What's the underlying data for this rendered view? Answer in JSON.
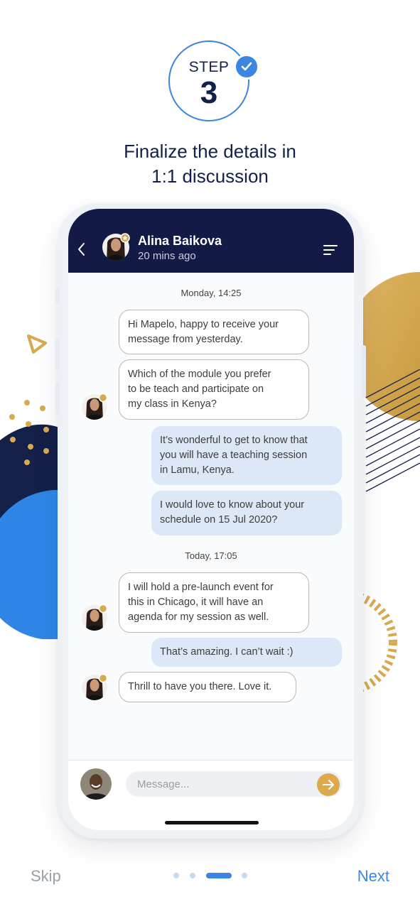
{
  "colors": {
    "accent": "#3b86e0",
    "navy": "#121a45",
    "gold": "#d7aa4f"
  },
  "step": {
    "label": "STEP",
    "number": "3",
    "icon": "checkmark-icon"
  },
  "headline": {
    "line1": "Finalize the details in",
    "line2": "1:1 discussion"
  },
  "chat": {
    "contact_name": "Alina Baikova",
    "contact_status": "20 mins ago",
    "icons": {
      "back": "chevron-left-icon",
      "menu": "filter-menu-icon",
      "favorite": "star-badge-icon"
    },
    "groups": [
      {
        "date": "Monday, 14:25"
      },
      {
        "date": "Today, 17:05"
      }
    ],
    "messages": [
      {
        "from": "contact",
        "text": "Hi Mapelo, happy to receive your\nmessage from yesterday."
      },
      {
        "from": "contact",
        "text": "Which of the module you prefer\nto be teach and participate on\nmy class in Kenya?"
      },
      {
        "from": "me",
        "text": "It’s wonderful to get to know that\nyou will have a teaching session\nin Lamu, Kenya."
      },
      {
        "from": "me",
        "text": "I would love to know about your\nschedule on 15 Jul 2020?"
      },
      {
        "from": "contact",
        "text": "I will hold a pre-launch event for\nthis in Chicago, it will have an\nagenda for my session as well."
      },
      {
        "from": "me",
        "text": "That’s amazing. I can’t wait :)"
      },
      {
        "from": "contact",
        "text": "Thrill to have you there. Love it."
      }
    ],
    "composer": {
      "placeholder": "Message...",
      "value": "",
      "send_icon": "arrow-right-icon"
    }
  },
  "footer": {
    "skip": "Skip",
    "next": "Next",
    "page_count": 4,
    "current_page": 3
  }
}
